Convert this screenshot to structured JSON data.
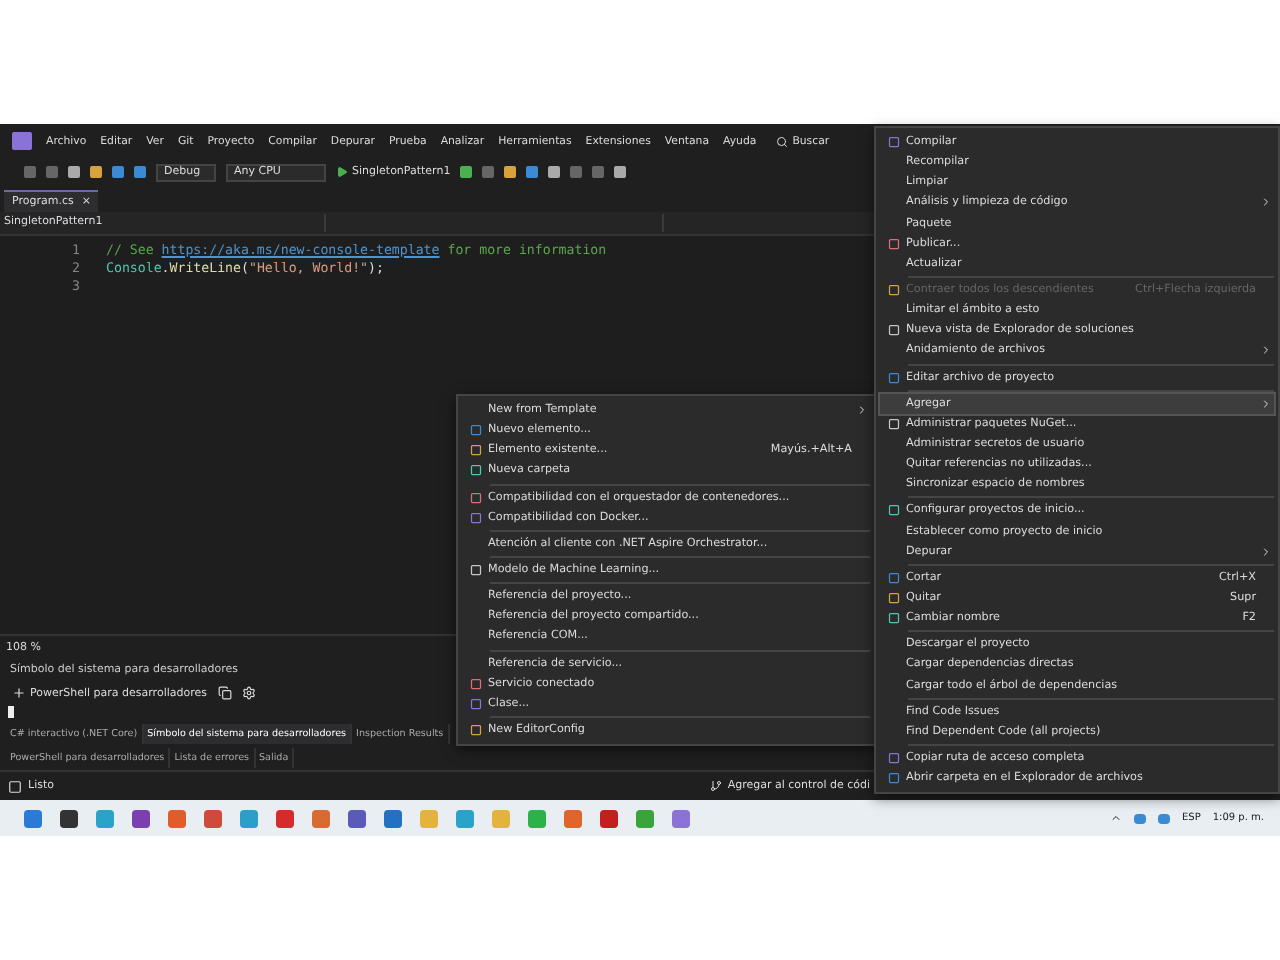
{
  "menubar": {
    "items": [
      "Archivo",
      "Editar",
      "Ver",
      "Git",
      "Proyecto",
      "Compilar",
      "Depurar",
      "Prueba",
      "Analizar",
      "Herramientas",
      "Extensiones",
      "Ventana",
      "Ayuda"
    ],
    "search": "Buscar"
  },
  "toolbar": {
    "configuration": "Debug",
    "platform": "Any CPU",
    "run_target": "SingletonPattern1"
  },
  "document_tab": {
    "title": "Program.cs",
    "close": "×"
  },
  "nav_bar": {
    "project": "SingletonPattern1"
  },
  "code": {
    "lines": [
      {
        "number": "1",
        "segments": [
          {
            "kind": "comment",
            "text": "// See "
          },
          {
            "kind": "link",
            "text": "https://aka.ms/new-console-template"
          },
          {
            "kind": "comment",
            "text": " for more information"
          }
        ]
      },
      {
        "number": "2",
        "segments": [
          {
            "kind": "class",
            "text": "Console"
          },
          {
            "kind": "method",
            "text": ".WriteLine"
          },
          {
            "kind": "plain",
            "text": "("
          },
          {
            "kind": "string",
            "text": "\"Hello, World!\""
          },
          {
            "kind": "plain",
            "text": ");"
          }
        ]
      },
      {
        "number": "3"
      }
    ]
  },
  "zoom": "108 %",
  "terminal": {
    "title": "Símbolo del sistema para desarrolladores",
    "shell": "PowerShell para desarrolladores"
  },
  "tool_tabs": [
    {
      "label": "C# interactivo (.NET Core)",
      "selected": false
    },
    {
      "label": "Símbolo del sistema para desarrolladores",
      "selected": true
    },
    {
      "label": "Inspection Results",
      "selected": false
    }
  ],
  "bottom_tabs": [
    {
      "label": "PowerShell para desarrolladores",
      "selected": false
    },
    {
      "label": "Lista de errores",
      "selected": false
    },
    {
      "label": "Salida",
      "selected": false
    }
  ],
  "status_bar": {
    "text": "Listo",
    "source_control": "Agregar al control de códi"
  },
  "context_menu": {
    "items": [
      {
        "kind": "icon-item",
        "label": "Compilar"
      },
      {
        "kind": "item",
        "label": "Recompilar"
      },
      {
        "kind": "item",
        "label": "Limpiar"
      },
      {
        "kind": "item",
        "label": "Análisis y limpieza de código",
        "submenu": true
      },
      {
        "kind": "item",
        "label": "Paquete"
      },
      {
        "kind": "icon-item",
        "label": "Publicar..."
      },
      {
        "kind": "item",
        "label": "Actualizar"
      },
      {
        "kind": "separator"
      },
      {
        "kind": "icon-item",
        "label": "Contraer todos los descendientes",
        "shortcut": "Ctrl+Flecha izquierda",
        "disabled": true
      },
      {
        "kind": "item",
        "label": "Limitar el ámbito a esto"
      },
      {
        "kind": "icon-item",
        "label": "Nueva vista de Explorador de soluciones"
      },
      {
        "kind": "item",
        "label": "Anidamiento de archivos",
        "submenu": true
      },
      {
        "kind": "separator"
      },
      {
        "kind": "icon-item",
        "label": "Editar archivo de proyecto"
      },
      {
        "kind": "separator"
      },
      {
        "kind": "item",
        "label": "Agregar",
        "submenu": true,
        "selected": true
      },
      {
        "kind": "icon-item",
        "label": "Administrar paquetes NuGet..."
      },
      {
        "kind": "item",
        "label": "Administrar secretos de usuario"
      },
      {
        "kind": "item",
        "label": "Quitar referencias no utilizadas..."
      },
      {
        "kind": "item",
        "label": "Sincronizar espacio de nombres"
      },
      {
        "kind": "separator"
      },
      {
        "kind": "icon-item",
        "label": "Configurar proyectos de inicio..."
      },
      {
        "kind": "item",
        "label": "Establecer como proyecto de inicio"
      },
      {
        "kind": "item",
        "label": "Depurar",
        "submenu": true
      },
      {
        "kind": "separator"
      },
      {
        "kind": "icon-item",
        "label": "Cortar",
        "shortcut": "Ctrl+X"
      },
      {
        "kind": "icon-item",
        "label": "Quitar",
        "shortcut": "Supr"
      },
      {
        "kind": "icon-item",
        "label": "Cambiar nombre",
        "shortcut": "F2"
      },
      {
        "kind": "separator"
      },
      {
        "kind": "item",
        "label": "Descargar el proyecto"
      },
      {
        "kind": "item",
        "label": "Cargar dependencias directas"
      },
      {
        "kind": "item",
        "label": "Cargar todo el árbol de dependencias"
      },
      {
        "kind": "separator"
      },
      {
        "kind": "item",
        "label": "Find Code Issues"
      },
      {
        "kind": "item",
        "label": "Find Dependent Code (all projects)"
      },
      {
        "kind": "separator"
      },
      {
        "kind": "icon-item",
        "label": "Copiar ruta de acceso completa"
      },
      {
        "kind": "icon-item",
        "label": "Abrir carpeta en el Explorador de archivos"
      }
    ]
  },
  "submenu": {
    "items": [
      {
        "kind": "item",
        "label": "New from Template",
        "submenu": true
      },
      {
        "kind": "icon-item",
        "label": "Nuevo elemento..."
      },
      {
        "kind": "icon-item",
        "label": "Elemento existente...",
        "shortcut": "Mayús.+Alt+A"
      },
      {
        "kind": "icon-item",
        "label": "Nueva carpeta"
      },
      {
        "kind": "separator"
      },
      {
        "kind": "icon-item",
        "label": "Compatibilidad con el orquestador de contenedores..."
      },
      {
        "kind": "icon-item",
        "label": "Compatibilidad con Docker..."
      },
      {
        "kind": "separator"
      },
      {
        "kind": "item",
        "label": "Atención al cliente con .NET Aspire Orchestrator..."
      },
      {
        "kind": "separator"
      },
      {
        "kind": "icon-item",
        "label": "Modelo de Machine Learning..."
      },
      {
        "kind": "separator"
      },
      {
        "kind": "item",
        "label": "Referencia del proyecto..."
      },
      {
        "kind": "item",
        "label": "Referencia del proyecto compartido..."
      },
      {
        "kind": "item",
        "label": "Referencia COM..."
      },
      {
        "kind": "separator"
      },
      {
        "kind": "item",
        "label": "Referencia de servicio..."
      },
      {
        "kind": "icon-item",
        "label": "Servicio conectado"
      },
      {
        "kind": "icon-item",
        "label": "Clase..."
      },
      {
        "kind": "separator"
      },
      {
        "kind": "icon-item",
        "label": "New EditorConfig"
      }
    ]
  },
  "tray": {
    "language": "ESP",
    "time": "1:09 p. m."
  }
}
